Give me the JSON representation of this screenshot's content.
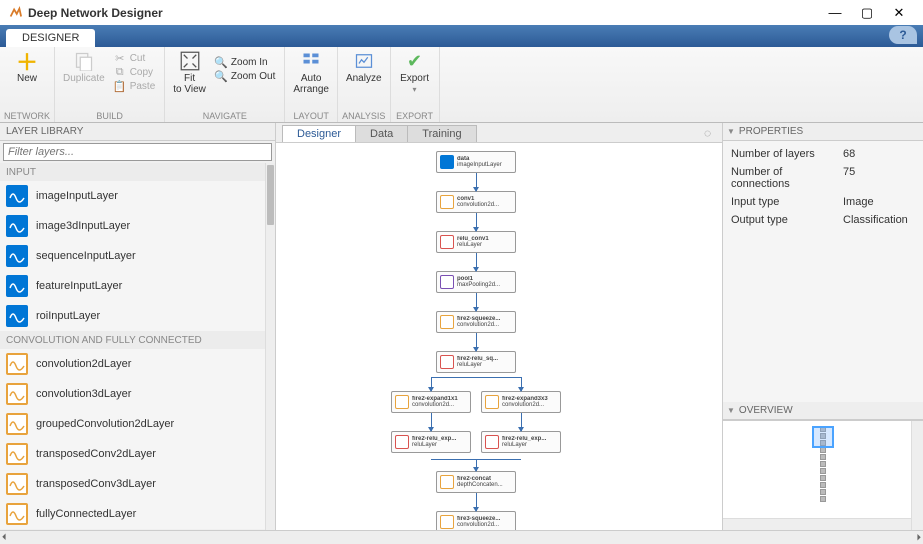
{
  "window": {
    "title": "Deep Network Designer"
  },
  "tabstrip": {
    "designer": "DESIGNER"
  },
  "toolstrip": {
    "new": "New",
    "duplicate": "Duplicate",
    "cut": "Cut",
    "copy": "Copy",
    "paste": "Paste",
    "fit": "Fit\nto View",
    "zoomin": "Zoom In",
    "zoomout": "Zoom Out",
    "autoarrange": "Auto\nArrange",
    "analyze": "Analyze",
    "export": "Export",
    "g_network": "NETWORK",
    "g_build": "BUILD",
    "g_navigate": "NAVIGATE",
    "g_layout": "LAYOUT",
    "g_analysis": "ANALYSIS",
    "g_export": "EXPORT"
  },
  "library": {
    "header": "LAYER LIBRARY",
    "filter_placeholder": "Filter layers...",
    "cat_input": "INPUT",
    "cat_conv": "CONVOLUTION AND FULLY CONNECTED",
    "input_layers": [
      "imageInputLayer",
      "image3dInputLayer",
      "sequenceInputLayer",
      "featureInputLayer",
      "roiInputLayer"
    ],
    "conv_layers": [
      "convolution2dLayer",
      "convolution3dLayer",
      "groupedConvolution2dLayer",
      "transposedConv2dLayer",
      "transposedConv3dLayer",
      "fullyConnectedLayer"
    ]
  },
  "canvas_tabs": {
    "designer": "Designer",
    "data": "Data",
    "training": "Training"
  },
  "nodes": {
    "n0": {
      "t": "data",
      "s": "imageInputLayer"
    },
    "n1": {
      "t": "conv1",
      "s": "convolution2d..."
    },
    "n2": {
      "t": "relu_conv1",
      "s": "reluLayer"
    },
    "n3": {
      "t": "pool1",
      "s": "maxPooling2d..."
    },
    "n4": {
      "t": "fire2-squeeze...",
      "s": "convolution2d..."
    },
    "n5": {
      "t": "fire2-relu_sq...",
      "s": "reluLayer"
    },
    "n6": {
      "t": "fire2-expand1x1",
      "s": "convolution2d..."
    },
    "n7": {
      "t": "fire2-expand3x3",
      "s": "convolution2d..."
    },
    "n8": {
      "t": "fire2-relu_exp...",
      "s": "reluLayer"
    },
    "n9": {
      "t": "fire2-relu_exp...",
      "s": "reluLayer"
    },
    "n10": {
      "t": "fire2-concat",
      "s": "depthConcaten..."
    },
    "n11": {
      "t": "fire3-squeeze...",
      "s": "convolution2d..."
    }
  },
  "props": {
    "header": "PROPERTIES",
    "rows": [
      {
        "k": "Number of layers",
        "v": "68"
      },
      {
        "k": "Number of connections",
        "v": "75"
      },
      {
        "k": "Input type",
        "v": "Image"
      },
      {
        "k": "Output type",
        "v": "Classification"
      }
    ]
  },
  "overview": {
    "header": "OVERVIEW"
  }
}
